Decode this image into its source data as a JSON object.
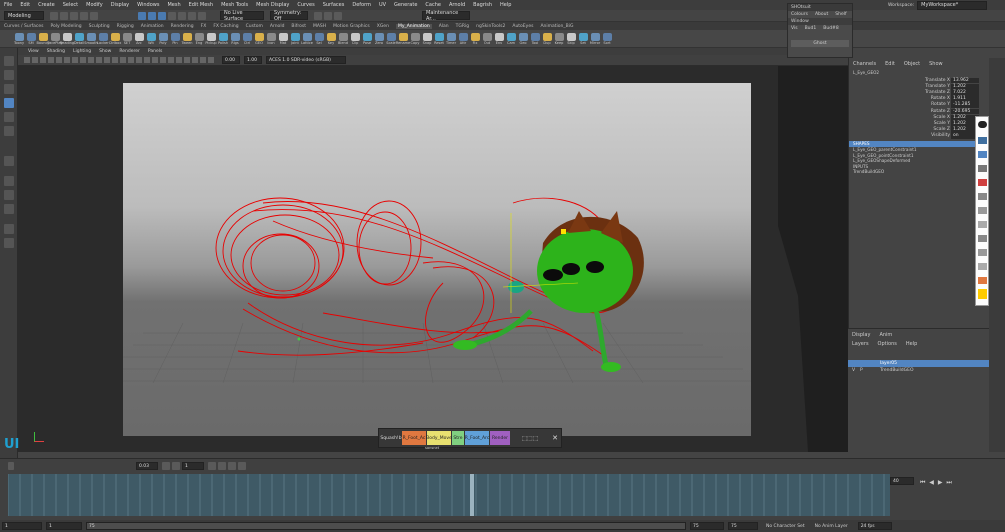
{
  "menubar": {
    "items": [
      "File",
      "Edit",
      "Create",
      "Select",
      "Modify",
      "Display",
      "Windows",
      "Mesh",
      "Edit Mesh",
      "Mesh Tools",
      "Mesh Display",
      "Curves",
      "Surfaces",
      "Deform",
      "UV",
      "Generate",
      "Cache",
      "Arnold",
      "Bagrish",
      "Help"
    ]
  },
  "workspace": {
    "label": "Workspace:",
    "value": "MyWorkspace*"
  },
  "status": {
    "mode": "Modeling",
    "live": "No Live Surface",
    "symmetry": "Symmetry: Off",
    "renderer": "Maintenance Ar..."
  },
  "shelf_tabs": {
    "items": [
      "Curves / Surfaces",
      "Poly Modeling",
      "Sculpting",
      "Rigging",
      "Animation",
      "Rendering",
      "FX",
      "FX Caching",
      "Custom",
      "Arnold",
      "Bifrost",
      "MASH",
      "Motion Graphics",
      "XGen",
      "My_Animation",
      "Alan",
      "TGRig",
      "ngSkinTools2",
      "AutoEyes",
      "Animation_BiG"
    ],
    "active_index": 14
  },
  "shelf_icons": [
    "Toony",
    "SM",
    "Bouncy",
    "FacePlay",
    "Reading",
    "Detail",
    "Smooth",
    "Locker",
    "Ctrlbox",
    "SET",
    "Arc",
    "Wit",
    "Poly",
    "Pin",
    "Tween",
    "Eng",
    "Pickup",
    "Polish",
    "Rigs",
    "Ctrl",
    "GEO",
    "Icon",
    "Mat",
    "Joint",
    "Lattice",
    "Sel",
    "Key",
    "Blend",
    "Clip",
    "Pose",
    "Zero",
    "Scale",
    "Rename",
    "Copy",
    "Snap",
    "Reset",
    "Timer",
    "Attr",
    "Fix",
    "Out",
    "Env",
    "Cam",
    "Geo",
    "Tool",
    "Dup",
    "Keep",
    "Skip",
    "Set",
    "Mirror",
    "Sort"
  ],
  "panel_menu": [
    "View",
    "Shading",
    "Lighting",
    "Show",
    "Renderer",
    "Panels"
  ],
  "panel_fields": {
    "value_a": "0.00",
    "value_b": "1.00",
    "colorspace": "ACES 1.0 SDR-video (sRGB)"
  },
  "viewport": {
    "marker": "UI"
  },
  "hud": {
    "chips": [
      "Squash!b",
      "R_Foot_Ac",
      "Body_Move",
      "Stre",
      "R_Foot_Arc",
      "Render"
    ],
    "chip_colors": [
      "#353535",
      "#e07840",
      "#e8e070",
      "#80d080",
      "#60a0d8",
      "#a060c0"
    ],
    "caption": "sansnet"
  },
  "popup": {
    "title": "SHOtsuit",
    "menu": [
      "Colours",
      "About",
      "Shelf"
    ],
    "window_label": "Window",
    "row": [
      "Vis",
      "Bud1",
      "Bud#8"
    ],
    "button": "Ghost"
  },
  "channel_box": {
    "menu": [
      "Channels",
      "Edit",
      "Object",
      "Show"
    ],
    "node": "L_Eye_GEO2",
    "attributes": [
      {
        "name": "Translate X",
        "value": "13.962"
      },
      {
        "name": "Translate Y",
        "value": "1.202"
      },
      {
        "name": "Translate Z",
        "value": "7.022"
      },
      {
        "name": "Rotate X",
        "value": "1.911"
      },
      {
        "name": "Rotate Y",
        "value": "-11.285"
      },
      {
        "name": "Rotate Z",
        "value": "-20.695"
      },
      {
        "name": "Scale X",
        "value": "1.202"
      },
      {
        "name": "Scale Y",
        "value": "1.202"
      },
      {
        "name": "Scale Z",
        "value": "1.202"
      },
      {
        "name": "Visibility",
        "value": "on"
      }
    ],
    "shapes_header": "SHAPES",
    "shapes": [
      "L_Eye_GEO_parentConstraint1",
      "L_Eye_GEO_pointConstraint1",
      "L_Eye_GEOShapeDeformed"
    ],
    "inputs_header": "INPUTS",
    "inputs": [
      "TrendBuildGEO"
    ]
  },
  "layer_editor": {
    "tabs": [
      "Display",
      "Anim"
    ],
    "menu": [
      "Layers",
      "Options",
      "Help"
    ],
    "rows": [
      {
        "v": "",
        "p": "",
        "name": "layer05"
      },
      {
        "v": "V",
        "p": "P",
        "name": "TrendBuildGEO"
      }
    ]
  },
  "right_swatches": [
    "#ffffff",
    "#3f6f9f",
    "#d04040",
    "#e08040",
    "#e0c040",
    "#70b050",
    "#4a8bd0",
    "#8a5fbf",
    "#222222",
    "#ffcc00"
  ],
  "timeline": {
    "field_a": "0.03",
    "field_b": "1",
    "current_frame": "40",
    "range_start": "1",
    "range_start2": "1",
    "range_end": "75",
    "range_end2": "75",
    "anim_end": "75",
    "character_set": "No Character Set",
    "anim_layer": "No Anim Layer",
    "fps": "24 fps"
  }
}
